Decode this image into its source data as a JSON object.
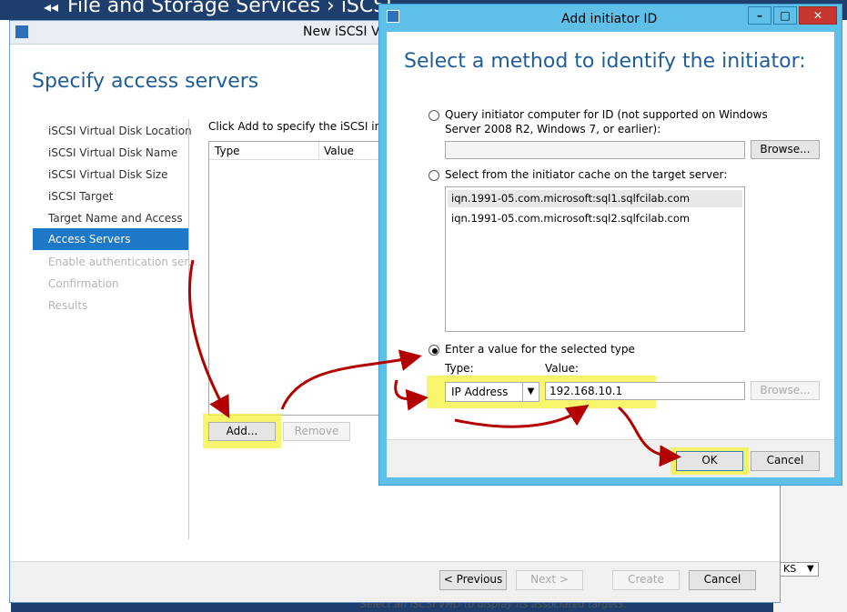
{
  "background": {
    "title": "File and Storage Services  ›  iSCSI",
    "footer_hint": "Select an iSCSI VHD to display its associated targets.",
    "right_dropdown": "KS"
  },
  "wizard": {
    "title": "New iSCSI V",
    "heading": "Specify access servers",
    "steps": [
      {
        "label": "iSCSI Virtual Disk Location"
      },
      {
        "label": "iSCSI Virtual Disk Name"
      },
      {
        "label": "iSCSI Virtual Disk Size"
      },
      {
        "label": "iSCSI Target"
      },
      {
        "label": "Target Name and Access"
      },
      {
        "label": "Access Servers"
      },
      {
        "label": "Enable authentication ser..."
      },
      {
        "label": "Confirmation"
      },
      {
        "label": "Results"
      }
    ],
    "instruction": "Click Add to specify the iSCSI initiat",
    "columns": [
      "Type",
      "Value"
    ],
    "add_label": "Add...",
    "remove_label": "Remove",
    "prev_label": "< Previous",
    "next_label": "Next >",
    "create_label": "Create",
    "cancel_label": "Cancel"
  },
  "dialog": {
    "title": "Add initiator ID",
    "heading": "Select a method to identify the initiator:",
    "option_query": "Query initiator computer for ID (not supported on Windows",
    "option_query_line2": "Server 2008 R2, Windows 7, or earlier):",
    "browse_label": "Browse...",
    "option_cache": "Select from the initiator cache on the target server:",
    "cache_items": [
      "iqn.1991-05.com.microsoft:sql1.sqlfcilab.com",
      "iqn.1991-05.com.microsoft:sql2.sqlfcilab.com"
    ],
    "option_value": "Enter a value for the selected type",
    "type_label": "Type:",
    "value_label": "Value:",
    "type_selected": "IP Address",
    "value_text": "192.168.10.1",
    "browse2_label": "Browse...",
    "ok_label": "OK",
    "cancel_label": "Cancel",
    "minimize_icon": "minimize-icon",
    "maximize_icon": "maximize-icon",
    "close_icon": "close-icon"
  },
  "colors": {
    "accent_blue": "#1e78c8",
    "heading_blue": "#1f5e96",
    "dialog_frame": "#5ebfe9",
    "highlight": "#f4f23a",
    "annotation_arrow": "#b30000",
    "close_button": "#c7362f"
  }
}
